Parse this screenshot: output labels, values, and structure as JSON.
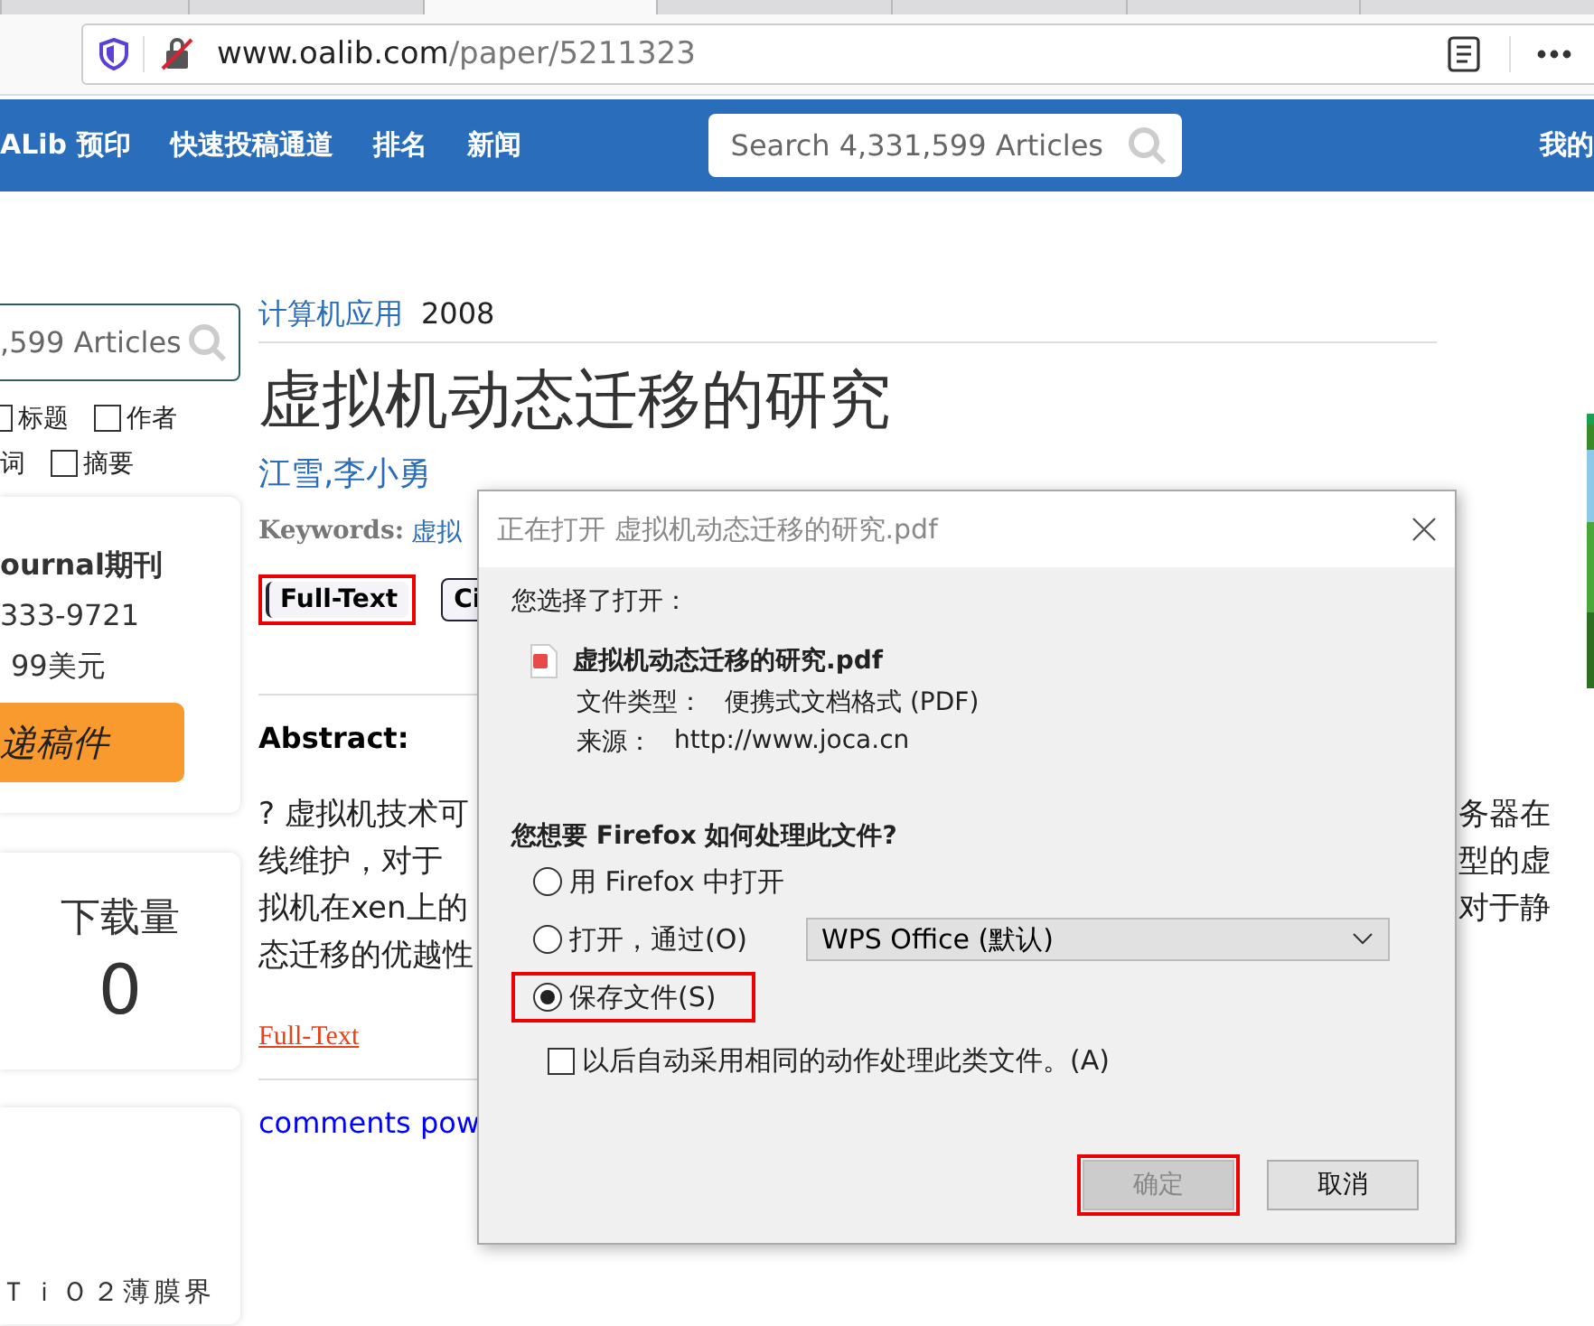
{
  "browser_tabs": [
    {
      "selected": false
    },
    {
      "selected": false
    },
    {
      "selected": true
    },
    {
      "selected": false
    },
    {
      "selected": false
    },
    {
      "selected": false
    },
    {
      "selected": false
    }
  ],
  "address_bar": {
    "domain": "www.oalib.com",
    "path": "/paper/5211323"
  },
  "nav": {
    "items": [
      "ALib 预印",
      "快速投稿通道",
      "排名",
      "新闻"
    ],
    "search_placeholder": "Search 4,331,599 Articles",
    "account": "我的"
  },
  "sidebar": {
    "search_placeholder": ",599 Articles",
    "filters": [
      [
        {
          "label": "标题",
          "checked": false,
          "kind": "checkbox"
        },
        {
          "label": "作者",
          "checked": false,
          "kind": "checkbox"
        }
      ],
      [
        {
          "label": "词",
          "kind": "text"
        },
        {
          "label": "摘要",
          "checked": false,
          "kind": "checkbox"
        }
      ]
    ],
    "journal_card": {
      "title": "ournal期刊",
      "issn": "333-9721",
      "price": "99美元",
      "button": "递稿件"
    },
    "download_card": {
      "label": "下载量",
      "count": "0"
    },
    "related_card": {
      "text": "ＴｉＯ２薄膜界"
    }
  },
  "article": {
    "journal": "计算机应用",
    "year": "2008",
    "title": "虚拟机动态迁移的研究",
    "authors": "江雪,李小勇",
    "keywords_label": "Keywords:",
    "keywords": "虚拟",
    "buttons": [
      {
        "label": "Full-Text",
        "highlighted": true
      },
      {
        "label": "Ci",
        "highlighted": false
      }
    ],
    "abstract_heading": "Abstract:",
    "abstract_lines": [
      {
        "left": "? 虚拟机技术可",
        "right": "务器在"
      },
      {
        "left": "线维护，对于",
        "right": "型的虚"
      },
      {
        "left": "拟机在xen上的",
        "right": "对于静"
      },
      {
        "left": "态迁移的优越性"
      }
    ],
    "full_text_link": "Full-Text",
    "comments": "comments pow"
  },
  "dialog": {
    "title": "正在打开 虚拟机动态迁移的研究.pdf",
    "intro": "您选择了打开：",
    "file_name": "虚拟机动态迁移的研究.pdf",
    "details": [
      {
        "label": "文件类型：",
        "value": "便携式文档格式 (PDF)"
      },
      {
        "label": "来源：",
        "value": "http://www.joca.cn"
      }
    ],
    "question": "您想要 Firefox 如何处理此文件?",
    "options": [
      {
        "label": "用 Firefox 中打开",
        "selected": false,
        "highlighted": false
      },
      {
        "label": "打开，通过(O)",
        "selected": false,
        "highlighted": false,
        "app": "WPS Office (默认)"
      },
      {
        "label": "保存文件(S)",
        "selected": true,
        "highlighted": true
      }
    ],
    "remember": {
      "label": "以后自动采用相同的动作处理此类文件。(A)",
      "checked": false
    },
    "buttons": [
      {
        "label": "确定",
        "disabled": true,
        "highlighted": true
      },
      {
        "label": "取消",
        "disabled": false,
        "highlighted": false
      }
    ]
  }
}
